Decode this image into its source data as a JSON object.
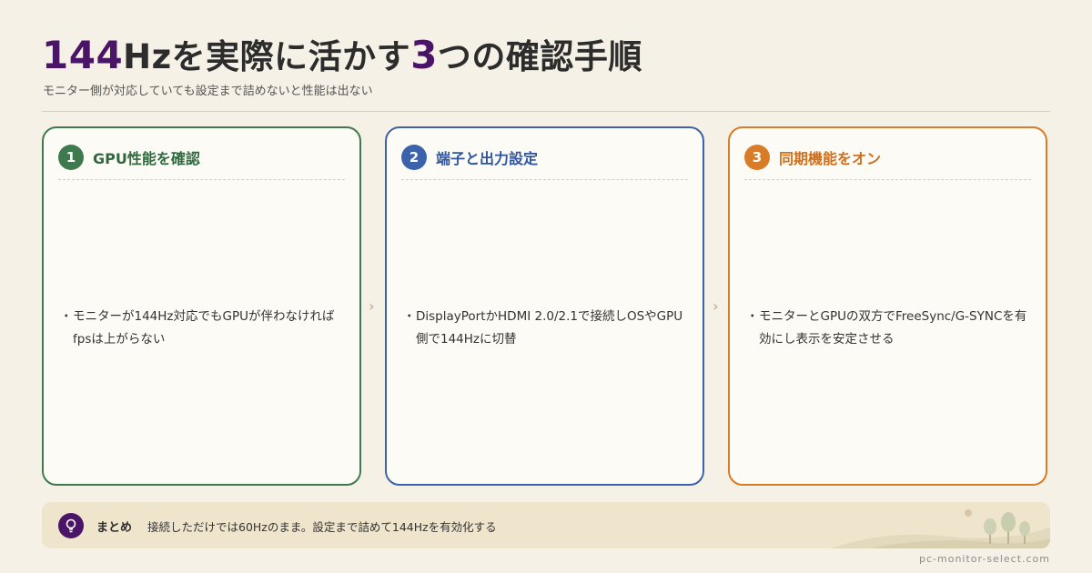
{
  "header": {
    "title_num1": "144",
    "title_part1": "Hzを実際に活かす",
    "title_num2": "3",
    "title_part2": "つの確認手順",
    "subtitle": "モニター側が対応していても設定まで詰めないと性能は出ない"
  },
  "steps": [
    {
      "number": "1",
      "title": "GPU性能を確認",
      "bullet": "モニターが144Hz対応でもGPUが伴わなければfpsは上がらない"
    },
    {
      "number": "2",
      "title": "端子と出力設定",
      "bullet": "DisplayPortかHDMI 2.0/2.1で接続しOSやGPU側で144Hzに切替"
    },
    {
      "number": "3",
      "title": "同期機能をオン",
      "bullet": "モニターとGPUの双方でFreeSync/G-SYNCを有効にし表示を安定させる"
    }
  ],
  "arrow_glyph": "›",
  "bullet_glyph": "・",
  "summary": {
    "label": "まとめ",
    "text": "接続しただけでは60Hzのまま。設定まで詰めて144Hzを有効化する"
  },
  "footer": {
    "site": "pc-monitor-select.com"
  },
  "colors": {
    "background": "#f6f1e6",
    "accent_purple": "#4a1566",
    "step1_green": "#3f7a4e",
    "step2_blue": "#3c62ab",
    "step3_orange": "#d97c28",
    "summary_bg": "#efe4cc"
  },
  "icons": {
    "summary": "lightbulb-icon",
    "step_separator": "chevron-right-icon"
  }
}
